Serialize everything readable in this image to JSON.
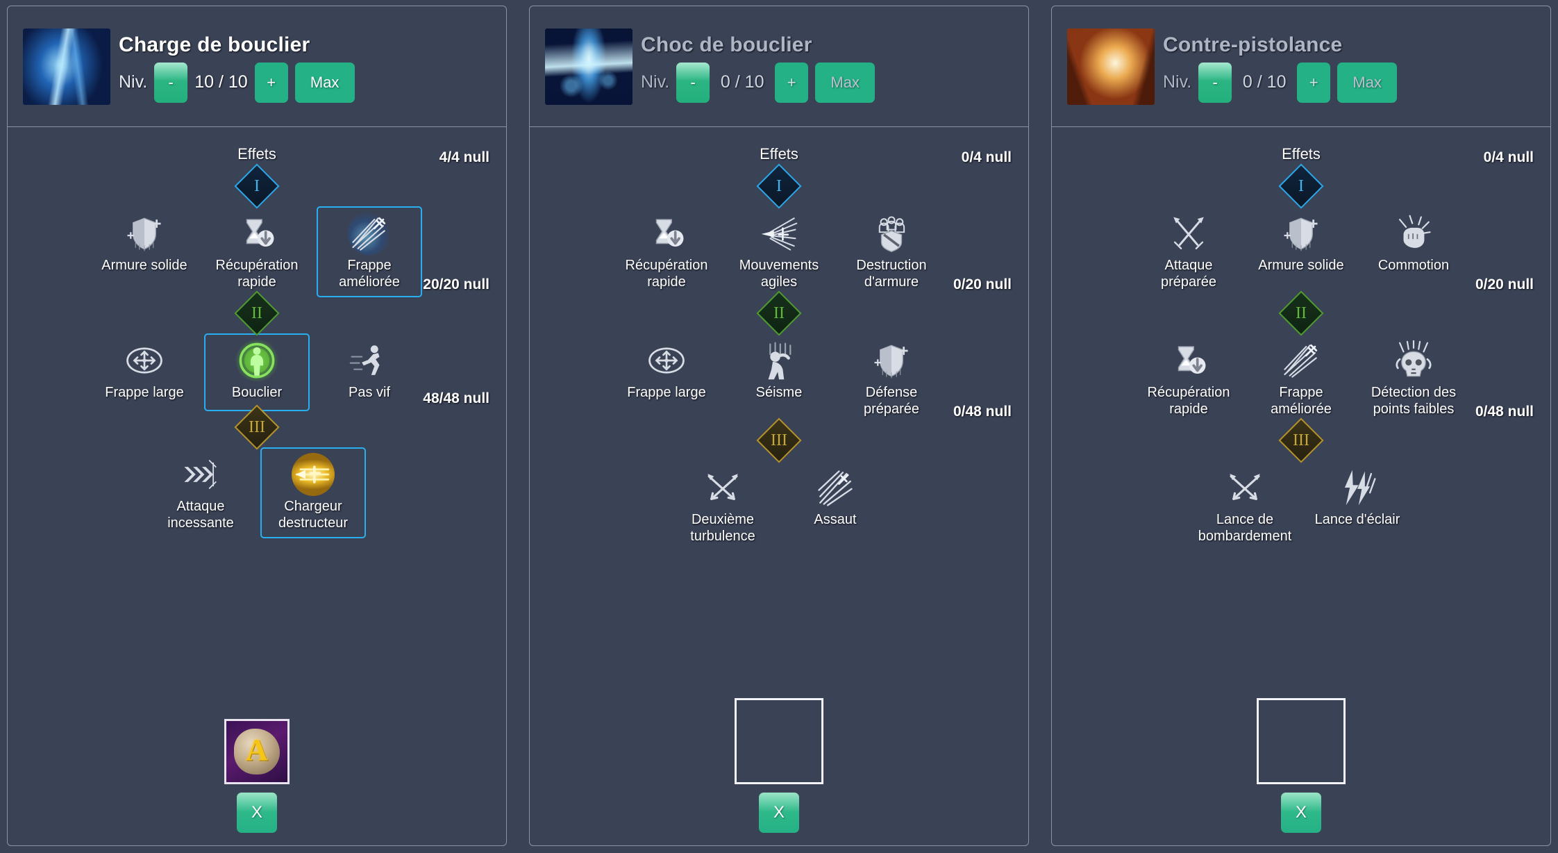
{
  "panels": [
    {
      "title": "Charge de bouclier",
      "thumb_class": "thumb-a",
      "dim": false,
      "level": {
        "label": "Niv.",
        "value": "10 / 10",
        "minus_label": "-",
        "plus_label": "+",
        "max_label": "Max"
      },
      "effects_label": "Effets",
      "tiers": [
        {
          "numeral": "I",
          "rank_class": "d1",
          "counter": "4/4 null",
          "nodes": [
            {
              "label": "Armure solide",
              "icon": "shield-plus-icon",
              "selected": false
            },
            {
              "label": "Récupération rapide",
              "icon": "hourglass-down-icon",
              "selected": false
            },
            {
              "label": "Frappe améliorée",
              "icon": "sword-burst-icon",
              "selected": true,
              "glow": "glow-blue"
            }
          ]
        },
        {
          "numeral": "II",
          "rank_class": "d2",
          "counter": "20/20 null",
          "nodes": [
            {
              "label": "Frappe large",
              "icon": "four-arrows-icon",
              "selected": false
            },
            {
              "label": "Bouclier",
              "icon": "figure-aura-icon",
              "selected": true,
              "glow": "glow-green"
            },
            {
              "label": "Pas vif",
              "icon": "running-figure-icon",
              "selected": false
            }
          ]
        },
        {
          "numeral": "III",
          "rank_class": "d3",
          "counter": "48/48 null",
          "nodes": [
            {
              "label": "Attaque incessante",
              "icon": "chevron-rush-icon",
              "selected": false
            },
            {
              "label": "Chargeur destructeur",
              "icon": "golden-lance-icon",
              "selected": true,
              "glow": "glow-gold"
            }
          ]
        }
      ],
      "slot": {
        "type": "rune",
        "glyph": "A",
        "close_label": "X"
      }
    },
    {
      "title": "Choc de bouclier",
      "thumb_class": "thumb-b",
      "dim": true,
      "level": {
        "label": "Niv.",
        "value": "0 / 10",
        "minus_label": "-",
        "plus_label": "+",
        "max_label": "Max"
      },
      "effects_label": "Effets",
      "tiers": [
        {
          "numeral": "I",
          "rank_class": "d1",
          "counter": "0/4 null",
          "nodes": [
            {
              "label": "Récupération rapide",
              "icon": "hourglass-down-icon",
              "selected": false
            },
            {
              "label": "Mouvements agiles",
              "icon": "swift-blade-icon",
              "selected": false
            },
            {
              "label": "Destruction d'armure",
              "icon": "broken-armor-icon",
              "selected": false
            }
          ]
        },
        {
          "numeral": "II",
          "rank_class": "d2",
          "counter": "0/20 null",
          "nodes": [
            {
              "label": "Frappe large",
              "icon": "four-arrows-icon",
              "selected": false
            },
            {
              "label": "Séisme",
              "icon": "quake-figure-icon",
              "selected": false
            },
            {
              "label": "Défense préparée",
              "icon": "shield-plus-icon",
              "selected": false
            }
          ]
        },
        {
          "numeral": "III",
          "rank_class": "d3",
          "counter": "0/48 null",
          "nodes": [
            {
              "label": "Deuxième turbulence",
              "icon": "crossed-arrows-icon",
              "selected": false
            },
            {
              "label": "Assaut",
              "icon": "spear-fan-icon",
              "selected": false
            }
          ]
        }
      ],
      "slot": {
        "type": "empty",
        "glyph": "",
        "close_label": "X"
      }
    },
    {
      "title": "Contre-pistolance",
      "thumb_class": "thumb-c",
      "dim": true,
      "level": {
        "label": "Niv.",
        "value": "0 / 10",
        "minus_label": "-",
        "plus_label": "+",
        "max_label": "Max"
      },
      "effects_label": "Effets",
      "tiers": [
        {
          "numeral": "I",
          "rank_class": "d1",
          "counter": "0/4 null",
          "nodes": [
            {
              "label": "Attaque préparée",
              "icon": "crossed-swords-icon",
              "selected": false
            },
            {
              "label": "Armure solide",
              "icon": "shield-plus-icon",
              "selected": false
            },
            {
              "label": "Commotion",
              "icon": "impact-fist-icon",
              "selected": false
            }
          ]
        },
        {
          "numeral": "II",
          "rank_class": "d2",
          "counter": "0/20 null",
          "nodes": [
            {
              "label": "Récupération rapide",
              "icon": "hourglass-down-icon",
              "selected": false
            },
            {
              "label": "Frappe améliorée",
              "icon": "sword-burst-icon",
              "selected": false
            },
            {
              "label": "Détection des points faibles",
              "icon": "skull-detect-icon",
              "selected": false
            }
          ]
        },
        {
          "numeral": "III",
          "rank_class": "d3",
          "counter": "0/48 null",
          "nodes": [
            {
              "label": "Lance de bombardement",
              "icon": "crossed-arrows-icon",
              "selected": false
            },
            {
              "label": "Lance d'éclair",
              "icon": "lightning-bolts-icon",
              "selected": false
            }
          ]
        }
      ],
      "slot": {
        "type": "empty",
        "glyph": "",
        "close_label": "X"
      }
    }
  ]
}
